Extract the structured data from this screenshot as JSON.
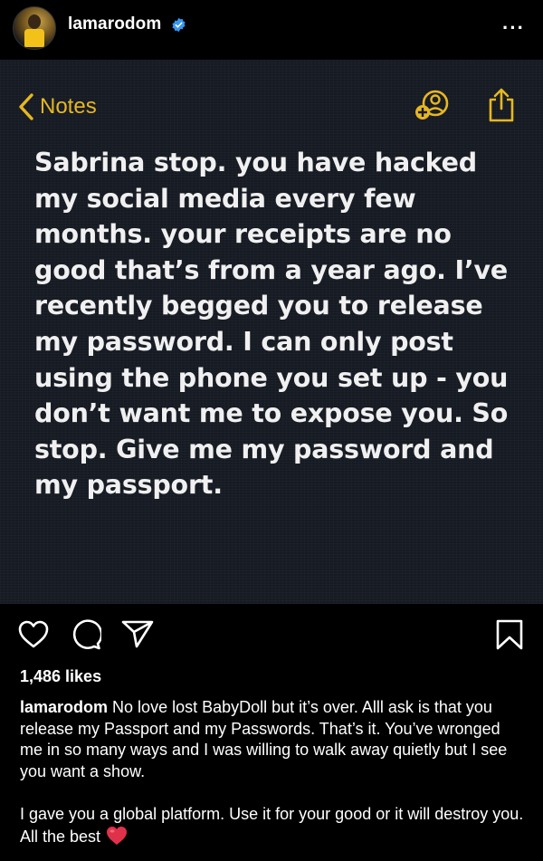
{
  "post": {
    "username": "lamarodom",
    "more_label": "···"
  },
  "note": {
    "back_label": "Notes",
    "text": "Sabrina stop. you have hacked my social media every few months. your receipts are no good that’s from a year ago. I’ve recently begged you to release my password. I can only post using the phone you set up - you don’t want me to expose you. So stop. Give me my password and my passport."
  },
  "likes": "1,486 likes",
  "caption": {
    "username": "lamarodom",
    "text1": "No love lost BabyDoll but it’s over. Alll ask is that you release my Passport and my Passwords. That’s it. You’ve wronged me in so many ways and I was willing to walk away quietly but I see you want a show.",
    "text2": "I gave you a global platform. Use it for your good or it will destroy you.  All the best"
  },
  "icons": {
    "verified": "verified-badge-icon",
    "heart": "heart-icon",
    "comment": "comment-icon",
    "share": "paper-plane-icon",
    "save": "bookmark-icon",
    "notes_share": "add-person-icon",
    "notes_export": "share-up-icon",
    "emoji": "red-heart-emoji"
  },
  "colors": {
    "background": "#000000",
    "note_background": "#161a23",
    "notes_accent": "#e6b722",
    "verified": "#3897f0",
    "emoji_heart": "#e0314b"
  }
}
